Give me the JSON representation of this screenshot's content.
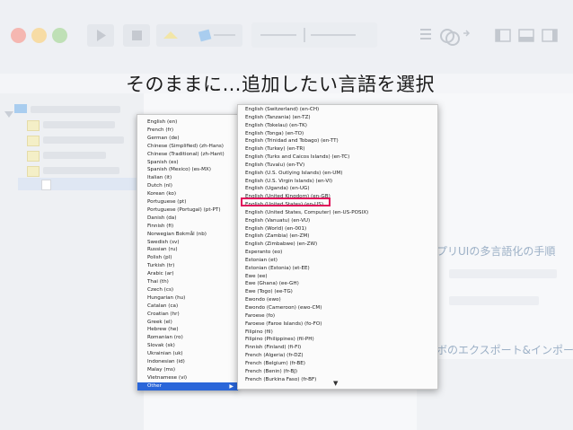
{
  "title": "そのままに…追加したい言語を選択",
  "background_texts": {
    "right_1": "プリUIの多言語化の手順",
    "right_2": "ボのエクスポート&インポート"
  },
  "colors": {
    "selection": "#2a66d9",
    "highlight": "#e0135b"
  },
  "left_menu": {
    "items": [
      "English (en)",
      "French (fr)",
      "German (de)",
      "Chinese (Simplified) (zh-Hans)",
      "Chinese (Traditional) (zh-Hant)",
      "Spanish (es)",
      "Spanish (Mexico) (es-MX)",
      "Italian (it)",
      "Dutch (nl)",
      "Korean (ko)",
      "Portuguese (pt)",
      "Portuguese (Portugal) (pt-PT)",
      "Danish (da)",
      "Finnish (fi)",
      "Norwegian Bokmål (nb)",
      "Swedish (sv)",
      "Russian (ru)",
      "Polish (pl)",
      "Turkish (tr)",
      "Arabic (ar)",
      "Thai (th)",
      "Czech (cs)",
      "Hungarian (hu)",
      "Catalan (ca)",
      "Croatian (hr)",
      "Greek (el)",
      "Hebrew (he)",
      "Romanian (ro)",
      "Slovak (sk)",
      "Ukrainian (uk)",
      "Indonesian (id)",
      "Malay (ms)",
      "Vietnamese (vi)"
    ],
    "selected": "Other",
    "selected_arrow": "▶"
  },
  "right_menu": {
    "items": [
      "English (Switzerland) (en-CH)",
      "English (Tanzania) (en-TZ)",
      "English (Tokelau) (en-TK)",
      "English (Tonga) (en-TO)",
      "English (Trinidad and Tobago) (en-TT)",
      "English (Turkey) (en-TR)",
      "English (Turks and Caicos Islands) (en-TC)",
      "English (Tuvalu) (en-TV)",
      "English (U.S. Outlying Islands) (en-UM)",
      "English (U.S. Virgin Islands) (en-VI)",
      "English (Uganda) (en-UG)",
      "English (United Kingdom) (en-GB)",
      "English (United States) (en-US)",
      "English (United States, Computer) (en-US-POSIX)",
      "English (Vanuatu) (en-VU)",
      "English (World) (en-001)",
      "English (Zambia) (en-ZM)",
      "English (Zimbabwe) (en-ZW)",
      "Esperanto (eo)",
      "Estonian (et)",
      "Estonian (Estonia) (et-EE)",
      "Ewe (ee)",
      "Ewe (Ghana) (ee-GH)",
      "Ewe (Togo) (ee-TG)",
      "Ewondo (ewo)",
      "Ewondo (Cameroon) (ewo-CM)",
      "Faroese (fo)",
      "Faroese (Faroe Islands) (fo-FO)",
      "Filipino (fil)",
      "Filipino (Philippines) (fil-PH)",
      "Finnish (Finland) (fi-FI)",
      "French (Algeria) (fr-DZ)",
      "French (Belgium) (fr-BE)",
      "French (Benin) (fr-BJ)",
      "French (Burkina Faso) (fr-BF)"
    ],
    "scroll_indicator": "▼"
  }
}
